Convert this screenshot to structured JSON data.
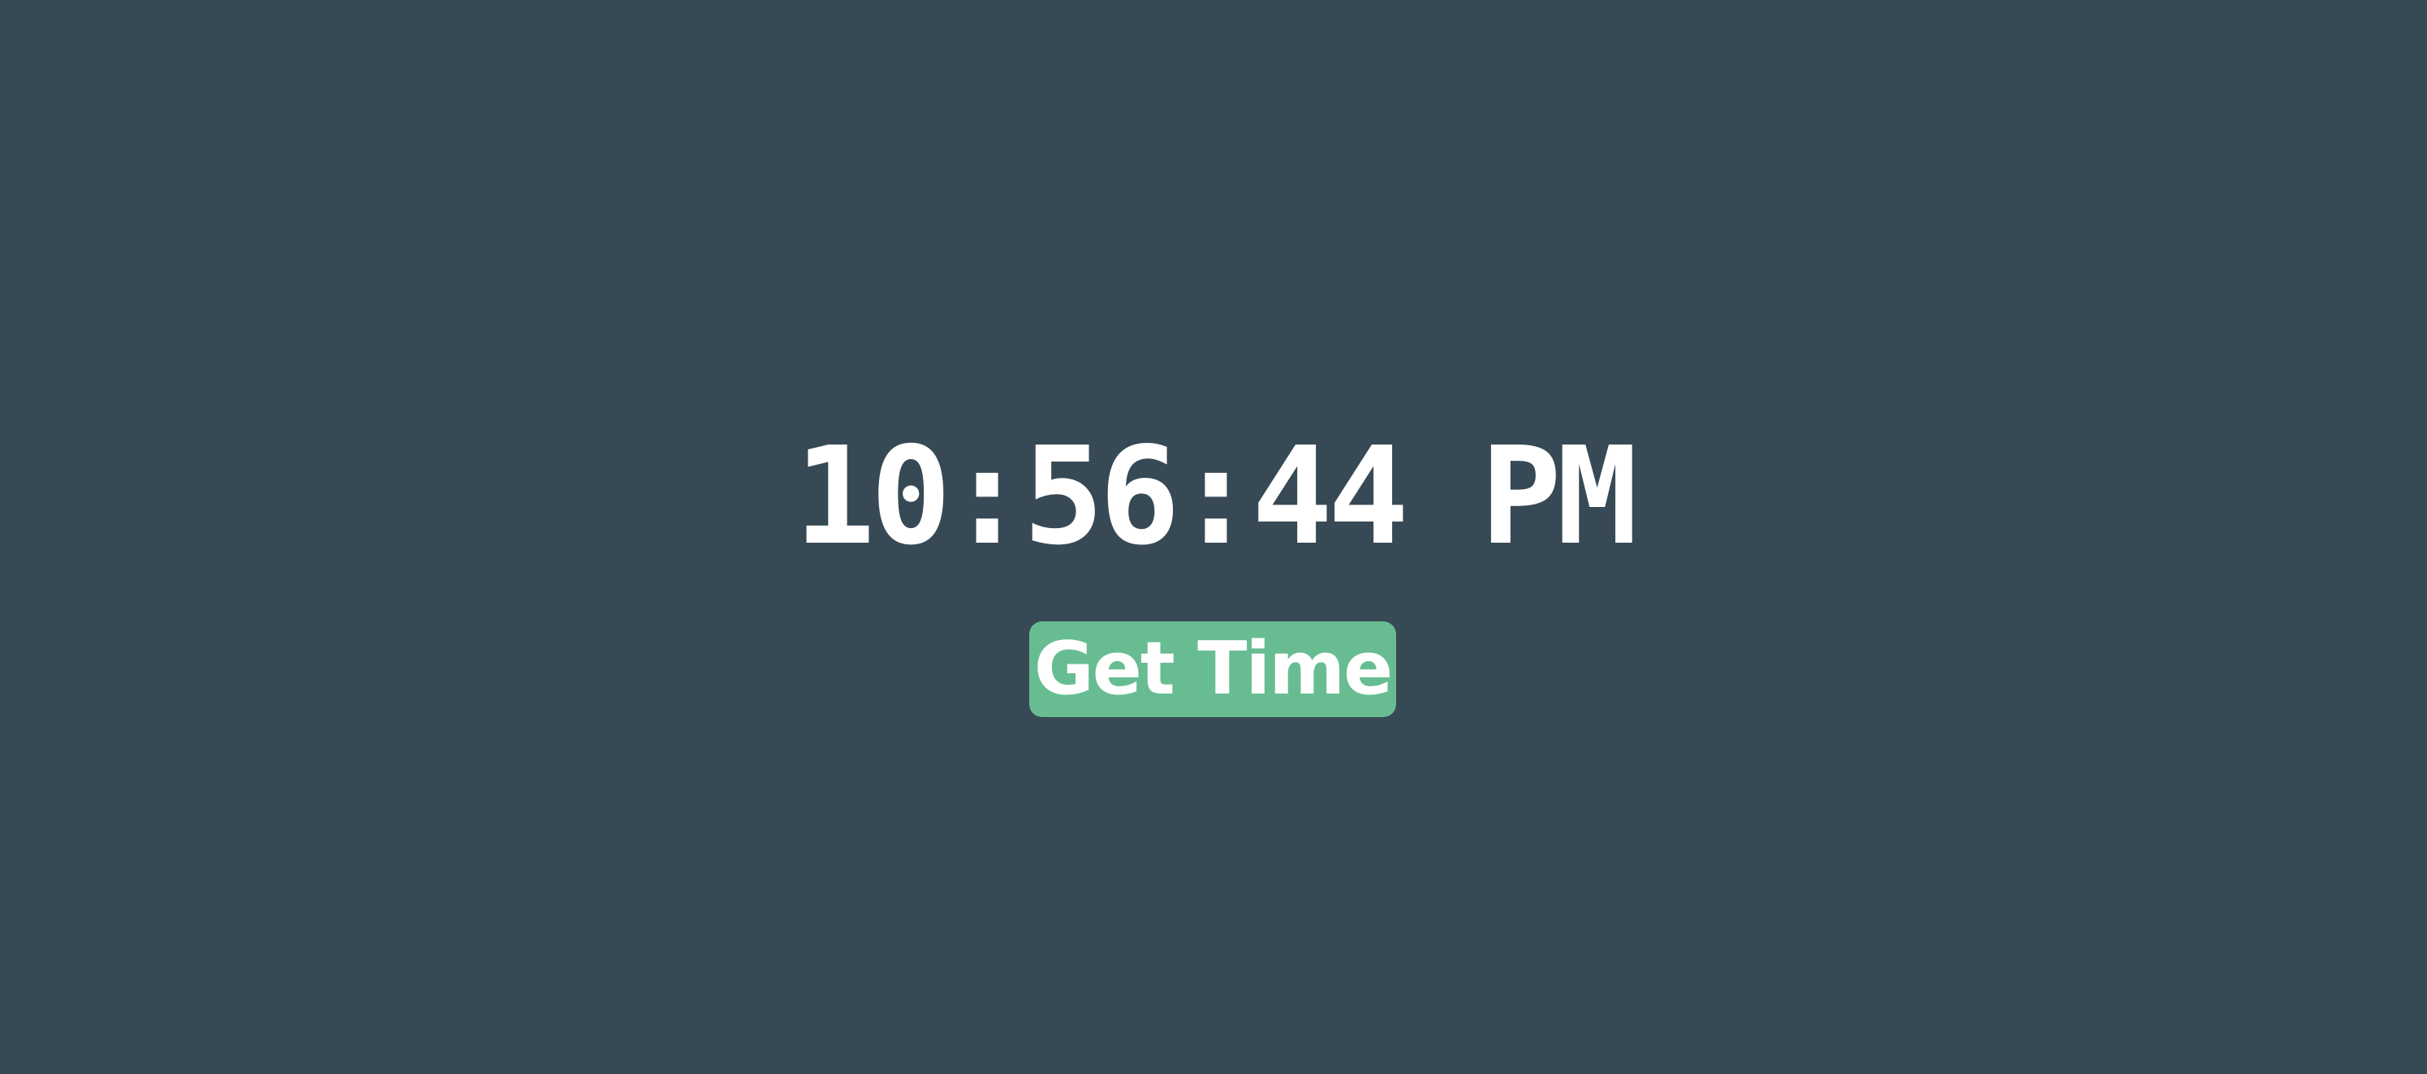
{
  "clock": {
    "time_text": "10:56:44 PM"
  },
  "button": {
    "label": "Get Time"
  },
  "colors": {
    "background": "#374955",
    "button": "#67bd91",
    "text": "#ffffff"
  }
}
